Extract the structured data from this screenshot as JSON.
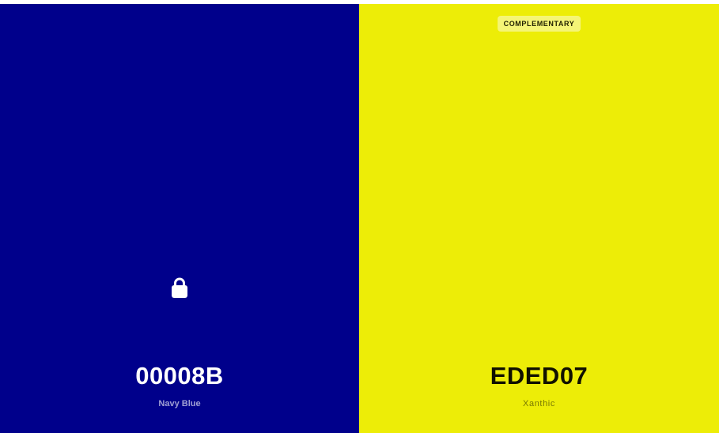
{
  "swatches": [
    {
      "hex": "00008B",
      "name": "Navy Blue",
      "color": "#00008B",
      "locked": true,
      "lock_icon": "lock-icon"
    },
    {
      "hex": "EDED07",
      "name": "Xanthic",
      "color": "#EDED07",
      "badge": "COMPLEMENTARY"
    }
  ]
}
